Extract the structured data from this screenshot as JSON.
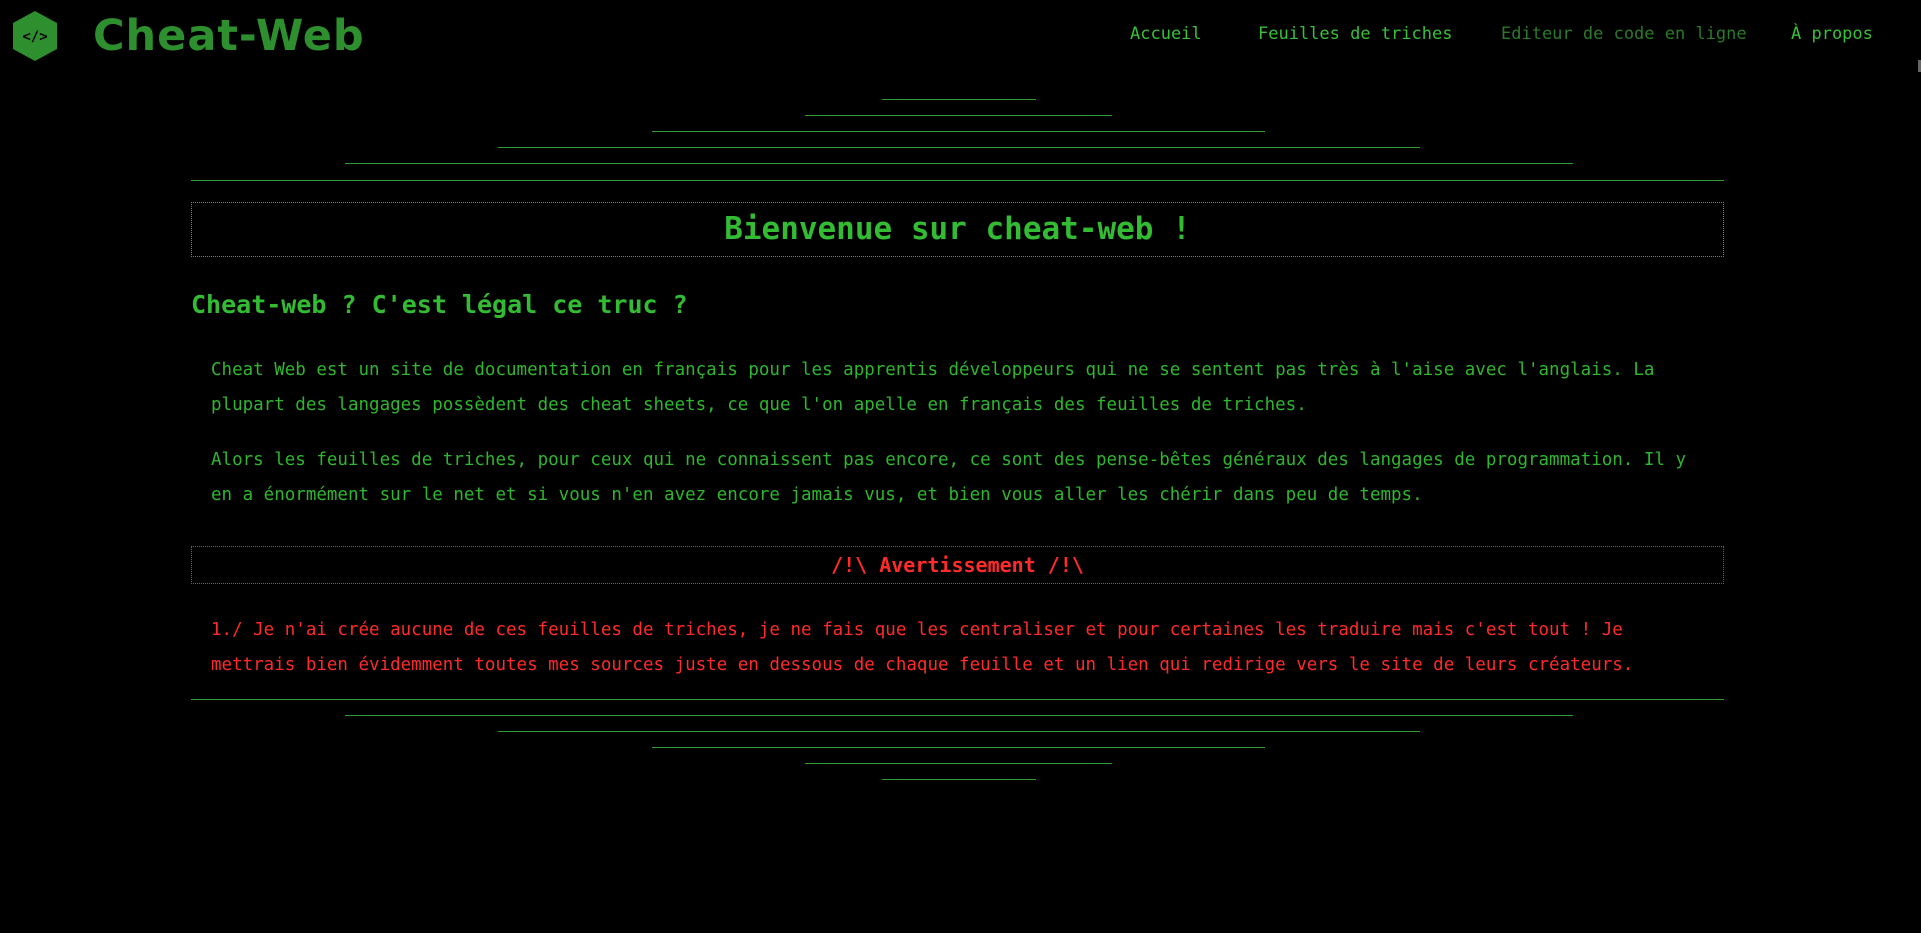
{
  "header": {
    "brand": "Cheat-Web",
    "logo_symbol": "</>",
    "nav": [
      {
        "label": "Accueil"
      },
      {
        "label": "Feuilles de triches"
      },
      {
        "label": "Editeur de code en ligne"
      },
      {
        "label": "À propos"
      }
    ]
  },
  "main": {
    "welcome_title": "Bienvenue sur cheat-web !",
    "section_title": "Cheat-web ? C'est légal ce truc ?",
    "paragraph_1": "Cheat Web est un site de documentation en français pour les apprentis développeurs qui ne se sentent pas très à l'aise avec l'anglais. La plupart des langages possèdent des cheat sheets, ce que l'on apelle en français des feuilles de triches.",
    "paragraph_2": "Alors les feuilles de triches, pour ceux qui ne connaissent pas encore, ce sont des pense-bêtes généraux des langages de programmation. Il y en a énormément sur le net et si vous n'en avez encore jamais vus, et bien vous aller les chérir dans peu de temps.",
    "warning_title": "/!\\ Avertissement /!\\",
    "warning_text": "1./ Je n'ai crée aucune de ces feuilles de triches, je ne fais que les centraliser et pour certaines les traduire mais c'est tout ! Je mettrais bien évidemment toutes mes sources juste en dessous de chaque feuille et un lien qui redirige vers le site de leurs créateurs."
  },
  "colors": {
    "background": "#000000",
    "accent_green": "#2fb52f",
    "warning_red": "#ff2a2a"
  },
  "icons": {
    "logo": "code-hexagon-icon"
  }
}
